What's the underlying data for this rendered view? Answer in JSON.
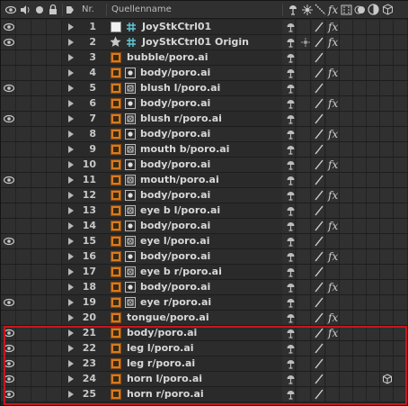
{
  "header": {
    "nr_label": "Nr.",
    "source_label": "Quellenname",
    "fx_label": "fx"
  },
  "rows": [
    {
      "nr": "1",
      "name": "JoyStkCtrl01",
      "type": "null",
      "eye": true,
      "fx": true,
      "motion_blur": false,
      "cube": false
    },
    {
      "nr": "2",
      "name": "JoyStkCtrl01 Origin",
      "type": "star",
      "eye": true,
      "fx": true,
      "motion_blur": false,
      "cube": false
    },
    {
      "nr": "3",
      "name": "bubble/poro.ai",
      "type": "ai",
      "eye": false,
      "fx": false,
      "motion_blur": false,
      "cube": false
    },
    {
      "nr": "4",
      "name": "body/poro.ai",
      "type": "ai-comp",
      "eye": false,
      "fx": true,
      "motion_blur": false,
      "cube": false
    },
    {
      "nr": "5",
      "name": "blush l/poro.ai",
      "type": "ai-box",
      "eye": true,
      "fx": false,
      "motion_blur": false,
      "cube": false
    },
    {
      "nr": "6",
      "name": "body/poro.ai",
      "type": "ai-comp",
      "eye": false,
      "fx": true,
      "motion_blur": false,
      "cube": false
    },
    {
      "nr": "7",
      "name": "blush r/poro.ai",
      "type": "ai-box",
      "eye": true,
      "fx": false,
      "motion_blur": false,
      "cube": false
    },
    {
      "nr": "8",
      "name": "body/poro.ai",
      "type": "ai-comp",
      "eye": false,
      "fx": true,
      "motion_blur": false,
      "cube": false
    },
    {
      "nr": "9",
      "name": "mouth b/poro.ai",
      "type": "ai-box",
      "eye": false,
      "fx": false,
      "motion_blur": false,
      "cube": false
    },
    {
      "nr": "10",
      "name": "body/poro.ai",
      "type": "ai-comp",
      "eye": false,
      "fx": true,
      "motion_blur": false,
      "cube": false
    },
    {
      "nr": "11",
      "name": "mouth/poro.ai",
      "type": "ai-box",
      "eye": true,
      "fx": false,
      "motion_blur": false,
      "cube": false
    },
    {
      "nr": "12",
      "name": "body/poro.ai",
      "type": "ai-comp",
      "eye": false,
      "fx": true,
      "motion_blur": false,
      "cube": false
    },
    {
      "nr": "13",
      "name": "eye b l/poro.ai",
      "type": "ai-box",
      "eye": false,
      "fx": false,
      "motion_blur": false,
      "cube": false
    },
    {
      "nr": "14",
      "name": "body/poro.ai",
      "type": "ai-comp",
      "eye": false,
      "fx": true,
      "motion_blur": false,
      "cube": false
    },
    {
      "nr": "15",
      "name": "eye l/poro.ai",
      "type": "ai-box",
      "eye": true,
      "fx": false,
      "motion_blur": false,
      "cube": false
    },
    {
      "nr": "16",
      "name": "body/poro.ai",
      "type": "ai-comp",
      "eye": false,
      "fx": true,
      "motion_blur": false,
      "cube": false
    },
    {
      "nr": "17",
      "name": "eye b r/poro.ai",
      "type": "ai-box",
      "eye": false,
      "fx": false,
      "motion_blur": false,
      "cube": false
    },
    {
      "nr": "18",
      "name": "body/poro.ai",
      "type": "ai-comp",
      "eye": false,
      "fx": true,
      "motion_blur": false,
      "cube": false
    },
    {
      "nr": "19",
      "name": "eye r/poro.ai",
      "type": "ai-box",
      "eye": true,
      "fx": false,
      "motion_blur": false,
      "cube": false
    },
    {
      "nr": "20",
      "name": "tongue/poro.ai",
      "type": "ai",
      "eye": false,
      "fx": true,
      "motion_blur": false,
      "cube": false
    },
    {
      "nr": "21",
      "name": "body/poro.ai",
      "type": "ai",
      "eye": true,
      "fx": true,
      "motion_blur": false,
      "cube": false
    },
    {
      "nr": "22",
      "name": "leg l/poro.ai",
      "type": "ai",
      "eye": true,
      "fx": false,
      "motion_blur": false,
      "cube": false
    },
    {
      "nr": "23",
      "name": "leg r/poro.ai",
      "type": "ai",
      "eye": true,
      "fx": false,
      "motion_blur": false,
      "cube": false
    },
    {
      "nr": "24",
      "name": "horn l/poro.ai",
      "type": "ai",
      "eye": true,
      "fx": false,
      "motion_blur": false,
      "cube": true
    },
    {
      "nr": "25",
      "name": "horn r/poro.ai",
      "type": "ai",
      "eye": true,
      "fx": false,
      "motion_blur": false,
      "cube": false
    }
  ],
  "colors": {
    "highlight": "#c8161d",
    "ai_orange": "#d77a1e",
    "null_cyan": "#5ec8d8"
  }
}
